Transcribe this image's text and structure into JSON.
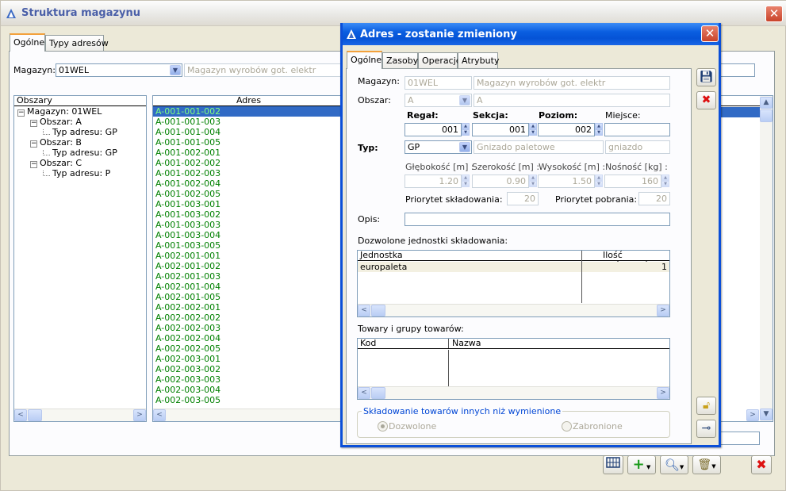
{
  "main": {
    "title": "Struktura magazynu",
    "tabs": [
      "Ogólne",
      "Typy adresów"
    ],
    "magazyn_label": "Magazyn:",
    "magazyn_value": "01WEL",
    "magazyn_name": "Magazyn wyrobów got. elektr",
    "tree_header": "Obszary",
    "tree": [
      {
        "text": "Magazyn: 01WEL",
        "level": 0,
        "toggle": "−"
      },
      {
        "text": "Obszar: A",
        "level": 1,
        "toggle": "−"
      },
      {
        "text": "Typ adresu: GP",
        "level": 2,
        "toggle": ""
      },
      {
        "text": "Obszar: B",
        "level": 1,
        "toggle": "−"
      },
      {
        "text": "Typ adresu: GP",
        "level": 2,
        "toggle": ""
      },
      {
        "text": "Obszar: C",
        "level": 1,
        "toggle": "−"
      },
      {
        "text": "Typ adresu: P",
        "level": 2,
        "toggle": ""
      }
    ],
    "list_header": "Adres",
    "addresses": [
      "A-001-001-002",
      "A-001-001-003",
      "A-001-001-004",
      "A-001-001-005",
      "A-001-002-001",
      "A-001-002-002",
      "A-001-002-003",
      "A-001-002-004",
      "A-001-002-005",
      "A-001-003-001",
      "A-001-003-002",
      "A-001-003-003",
      "A-001-003-004",
      "A-001-003-005",
      "A-002-001-001",
      "A-002-001-002",
      "A-002-001-003",
      "A-002-001-004",
      "A-002-001-005",
      "A-002-002-001",
      "A-002-002-002",
      "A-002-002-003",
      "A-002-002-004",
      "A-002-002-005",
      "A-002-003-001",
      "A-002-003-002",
      "A-002-003-003",
      "A-002-003-004",
      "A-002-003-005"
    ]
  },
  "dialog": {
    "title": "Adres - zostanie zmieniony",
    "tabs": [
      "Ogólne",
      "Zasoby",
      "Operacje",
      "Atrybuty"
    ],
    "magazyn_label": "Magazyn:",
    "magazyn_value": "01WEL",
    "magazyn_name": "Magazyn wyrobów got. elektr",
    "obszar_label": "Obszar:",
    "obszar_value": "A",
    "obszar_name": "A",
    "regal_label": "Regał:",
    "sekcja_label": "Sekcja:",
    "poziom_label": "Poziom:",
    "miejsce_label": "Miejsce:",
    "regal_value": "001",
    "sekcja_value": "001",
    "poziom_value": "002",
    "miejsce_value": "",
    "typ_label": "Typ:",
    "typ_value": "GP",
    "typ_name": "Gnizado paletowe",
    "typ_kind": "gniazdo",
    "glebokosc_label": "Głębokość [m] :",
    "szerokosc_label": "Szerokość [m] :",
    "wysokosc_label": "Wysokość [m] :",
    "nosnosc_label": "Nośność [kg] :",
    "glebokosc_value": "1.20",
    "szerokosc_value": "0.90",
    "wysokosc_value": "1.50",
    "nosnosc_value": "160",
    "priorytet_skl_label": "Priorytet składowania:",
    "priorytet_skl_value": "20",
    "priorytet_pob_label": "Priorytet pobrania:",
    "priorytet_pob_value": "20",
    "opis_label": "Opis:",
    "opis_value": "",
    "units_title": "Dozwolone jednostki składowania:",
    "units_cols": [
      "Jednostka",
      "Ilość maksymalna"
    ],
    "units_rows": [
      {
        "name": "europaleta",
        "qty": "1"
      }
    ],
    "goods_title": "Towary i grupy towarów:",
    "goods_cols": [
      "Kod",
      "Nazwa"
    ],
    "storage_group_title": "Składowanie towarów innych niż wymienione",
    "radio_allowed": "Dozwolone",
    "radio_forbidden": "Zabronione",
    "radio_selected": "Dozwolone"
  },
  "colors": {
    "accent_blue": "#0a5ee0",
    "green_text": "#008000",
    "selection": "#316ac5"
  }
}
